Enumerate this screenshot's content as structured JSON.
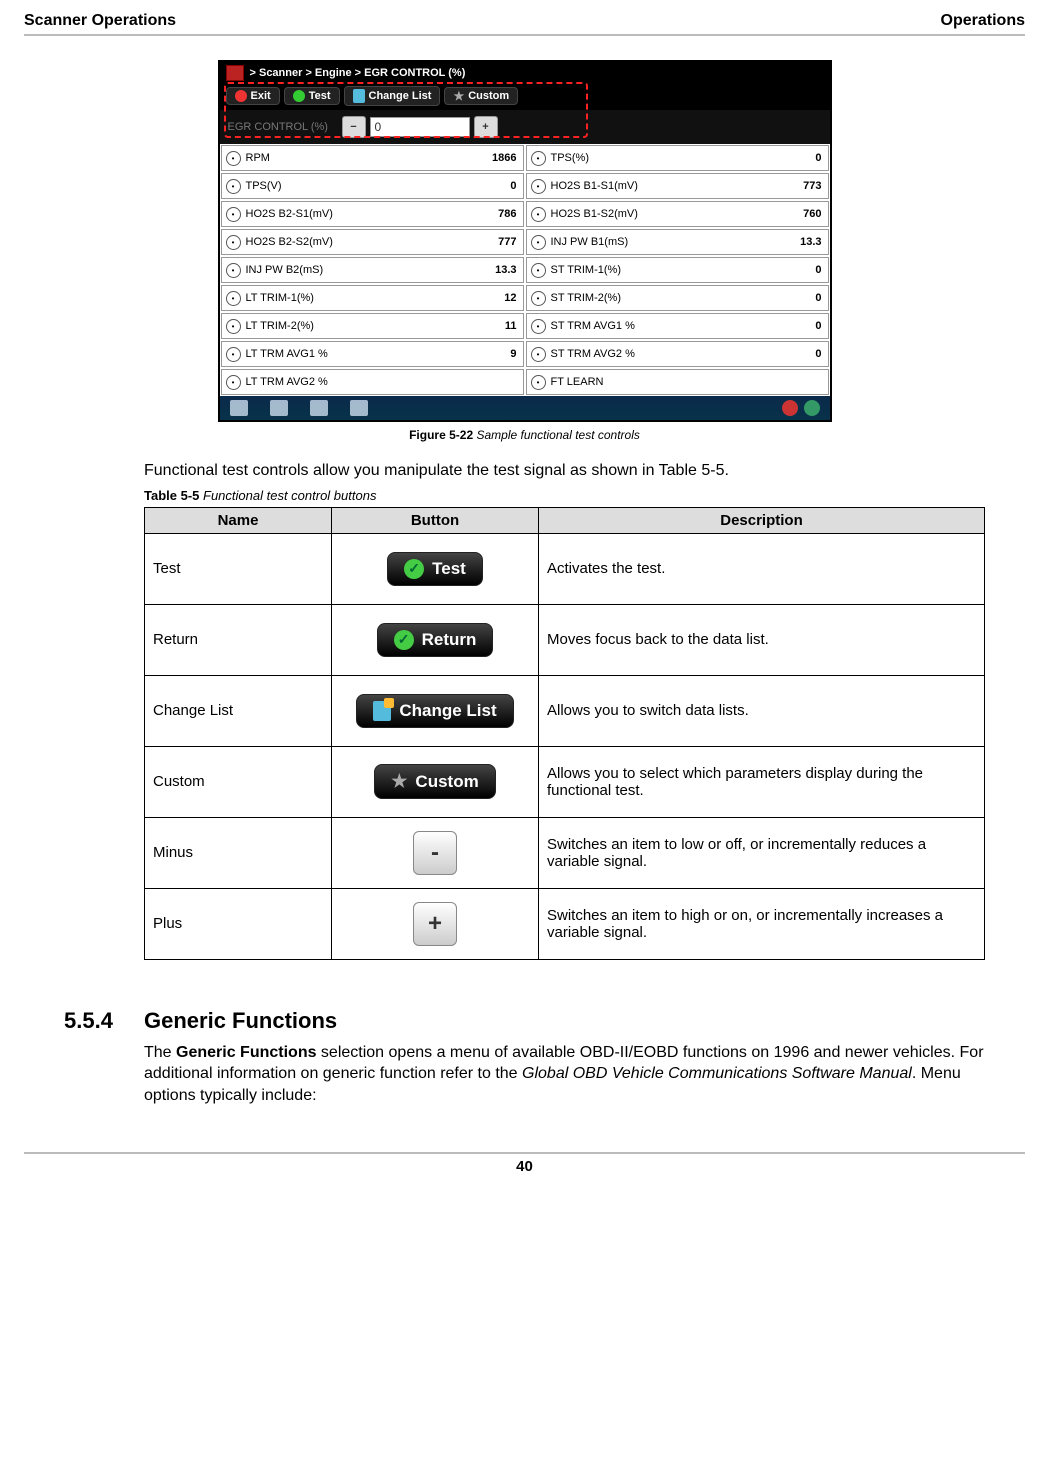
{
  "header": {
    "left": "Scanner Operations",
    "right": "Operations"
  },
  "screenshot": {
    "breadcrumb": "> Scanner  > Engine  > EGR CONTROL (%)",
    "toolbar": {
      "exit": "Exit",
      "test": "Test",
      "change_list": "Change List",
      "custom": "Custom"
    },
    "control": {
      "label": "EGR CONTROL (%)",
      "minus": "−",
      "value": "0",
      "plus": "+"
    },
    "params_left": [
      {
        "name": "RPM",
        "value": "1866"
      },
      {
        "name": "TPS(V)",
        "value": "0"
      },
      {
        "name": "HO2S B2-S1(mV)",
        "value": "786"
      },
      {
        "name": "HO2S B2-S2(mV)",
        "value": "777"
      },
      {
        "name": "INJ PW B2(mS)",
        "value": "13.3"
      },
      {
        "name": "LT TRIM-1(%)",
        "value": "12"
      },
      {
        "name": "LT TRIM-2(%)",
        "value": "11"
      },
      {
        "name": "LT TRM AVG1 %",
        "value": "9"
      },
      {
        "name": "LT TRM AVG2 %",
        "value": ""
      }
    ],
    "params_right": [
      {
        "name": "TPS(%)",
        "value": "0"
      },
      {
        "name": "HO2S B1-S1(mV)",
        "value": "773"
      },
      {
        "name": "HO2S B1-S2(mV)",
        "value": "760"
      },
      {
        "name": "INJ PW B1(mS)",
        "value": "13.3"
      },
      {
        "name": "ST TRIM-1(%)",
        "value": "0"
      },
      {
        "name": "ST TRIM-2(%)",
        "value": "0"
      },
      {
        "name": "ST TRM AVG1 %",
        "value": "0"
      },
      {
        "name": "ST TRM AVG2 %",
        "value": "0"
      },
      {
        "name": "FT LEARN",
        "value": ""
      }
    ]
  },
  "figure_caption": {
    "label": "Figure 5-22",
    "text": "Sample functional test controls"
  },
  "intro_para": "Functional test controls allow you manipulate the test signal as shown in Table 5-5.",
  "table_caption": {
    "label": "Table 5-5",
    "text": "Functional test control buttons"
  },
  "table_headers": {
    "name": "Name",
    "button": "Button",
    "desc": "Description"
  },
  "table_rows": [
    {
      "name": "Test",
      "btn_label": "Test",
      "btn_kind": "green",
      "desc": "Activates the test."
    },
    {
      "name": "Return",
      "btn_label": "Return",
      "btn_kind": "green",
      "desc": "Moves focus back to the data list."
    },
    {
      "name": "Change List",
      "btn_label": "Change List",
      "btn_kind": "doc",
      "desc": "Allows you to switch data lists."
    },
    {
      "name": "Custom",
      "btn_label": "Custom",
      "btn_kind": "star",
      "desc": "Allows you to select which parameters display during the functional test."
    },
    {
      "name": "Minus",
      "btn_label": "-",
      "btn_kind": "square",
      "desc": "Switches an item to low or off, or incrementally reduces a variable signal."
    },
    {
      "name": "Plus",
      "btn_label": "+",
      "btn_kind": "square",
      "desc": "Switches an item to high or on, or incrementally increases a variable signal."
    }
  ],
  "section": {
    "number": "5.5.4",
    "title": "Generic Functions",
    "para_pre": "The ",
    "para_bold": "Generic Functions",
    "para_mid": " selection opens a menu of available OBD-II/EOBD functions on 1996 and newer vehicles. For additional information on generic function refer to the ",
    "para_italic": "Global OBD Vehicle Communications Software Manual",
    "para_post": ". Menu options typically include:"
  },
  "page_number": "40"
}
